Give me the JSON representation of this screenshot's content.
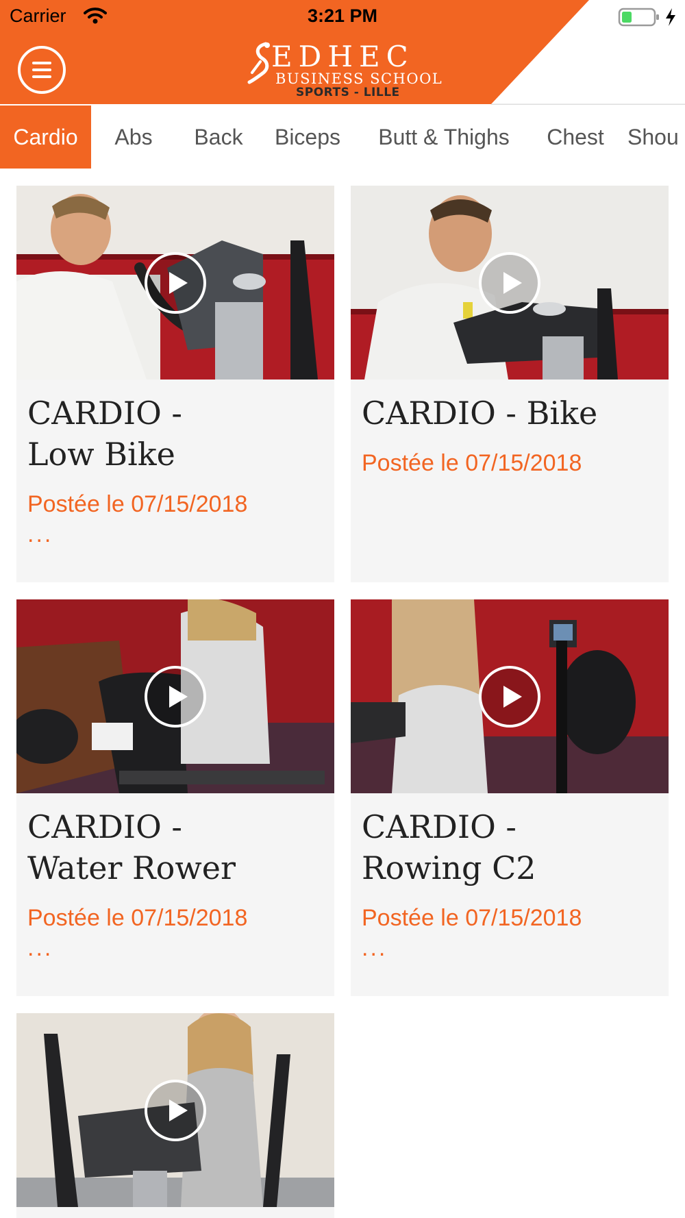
{
  "status_bar": {
    "carrier": "Carrier",
    "time": "3:21 PM",
    "wifi_icon": "wifi-icon",
    "battery_icon": "battery-charging-icon"
  },
  "header": {
    "menu_icon": "hamburger-menu-icon",
    "logo": {
      "name": "EDHEC",
      "subtitle": "BUSINESS SCHOOL",
      "tagline": "SPORTS - LILLE"
    },
    "accent_color": "#f26522"
  },
  "tabs": [
    {
      "label": "Cardio",
      "active": true
    },
    {
      "label": "Abs",
      "active": false
    },
    {
      "label": "Back",
      "active": false
    },
    {
      "label": "Biceps",
      "active": false
    },
    {
      "label": "Butt & Thighs",
      "active": false
    },
    {
      "label": "Chest",
      "active": false
    },
    {
      "label": "Shou",
      "active": false
    }
  ],
  "videos": [
    {
      "title_line1": "CARDIO -",
      "title_line2": "Low Bike",
      "date": "Postée le 07/15/2018",
      "more": "..."
    },
    {
      "title_line1": "CARDIO - Bike",
      "title_line2": "",
      "date": "Postée le 07/15/2018",
      "more": ""
    },
    {
      "title_line1": "CARDIO -",
      "title_line2": "Water Rower",
      "date": "Postée le 07/15/2018",
      "more": "..."
    },
    {
      "title_line1": "CARDIO -",
      "title_line2": "Rowing C2",
      "date": "Postée le 07/15/2018",
      "more": "..."
    },
    {
      "title_line1": "",
      "title_line2": "",
      "date": "",
      "more": ""
    }
  ]
}
